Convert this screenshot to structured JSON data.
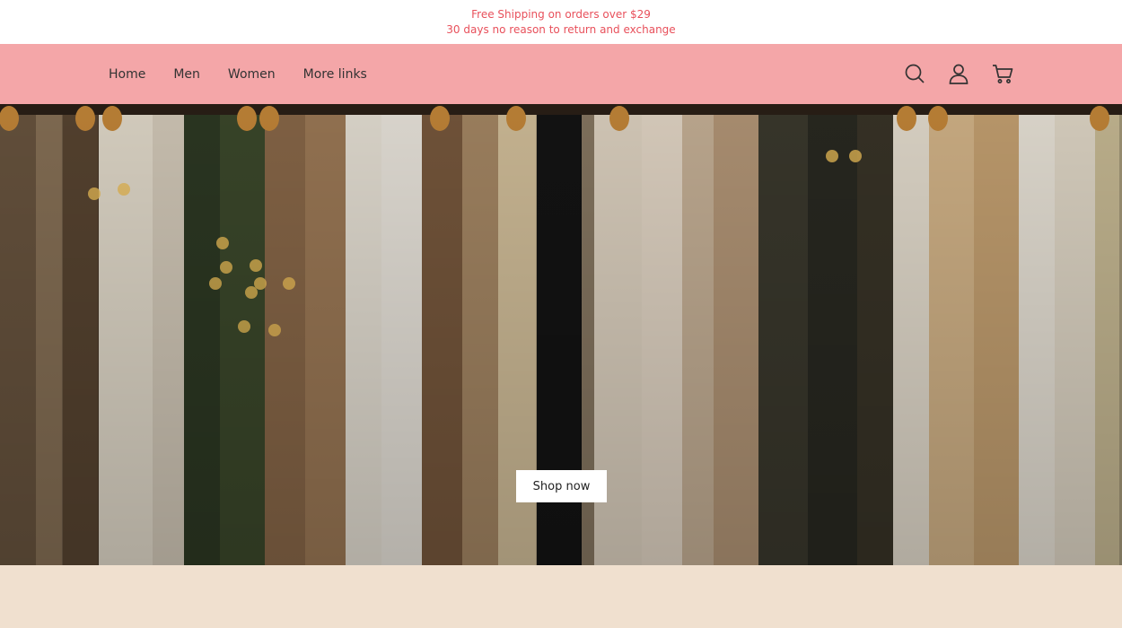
{
  "announcement": {
    "line1": "Free Shipping on orders over $29",
    "line2": "30 days no reason to return and exchange"
  },
  "nav": {
    "links": [
      {
        "label": "Home"
      },
      {
        "label": "Men"
      },
      {
        "label": "Women"
      },
      {
        "label": "More links"
      }
    ],
    "icons": [
      "search-icon",
      "account-icon",
      "cart-icon"
    ]
  },
  "hero": {
    "image": "clothes-rack-photo",
    "button_label": "Shop now"
  },
  "colors": {
    "accent_text": "#e8505b",
    "nav_background": "#f4a6a8",
    "footer_background": "#f0e0cf"
  }
}
